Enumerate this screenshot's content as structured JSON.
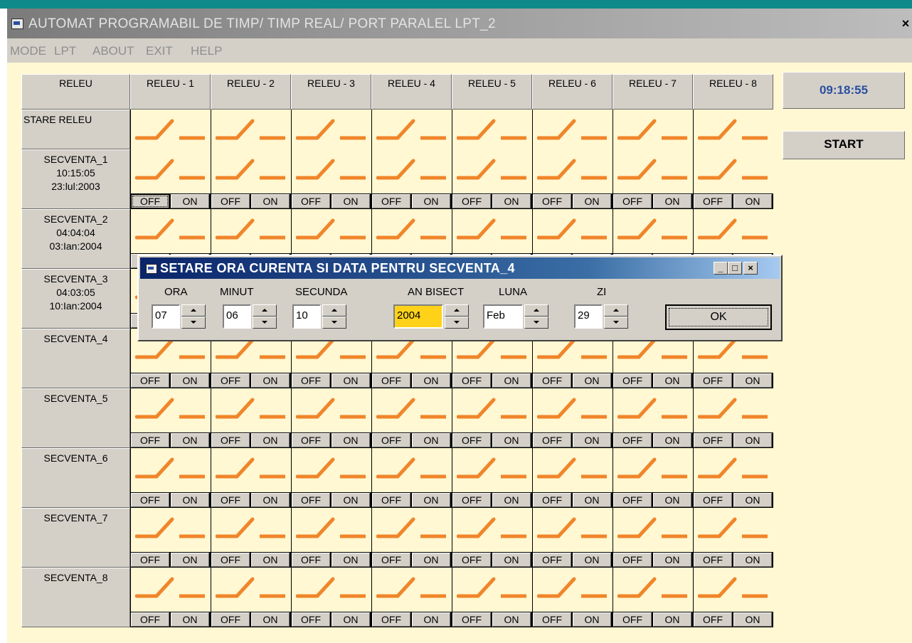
{
  "window": {
    "title": "AUTOMAT PROGRAMABIL DE TIMP/ TIMP REAL/ PORT PARALEL LPT_2",
    "close_glyph": "×"
  },
  "menu": [
    {
      "label": "MODE"
    },
    {
      "label": "LPT"
    },
    {
      "label": "ABOUT"
    },
    {
      "label": "EXIT"
    },
    {
      "label": "HELP"
    }
  ],
  "grid": {
    "corner_label": "RELEU",
    "relays": [
      "RELEU - 1",
      "RELEU - 2",
      "RELEU - 3",
      "RELEU - 4",
      "RELEU - 5",
      "RELEU - 6",
      "RELEU - 7",
      "RELEU - 8"
    ],
    "state_row_label": "STARE RELEU",
    "off_label": "OFF",
    "on_label": "ON",
    "sequences": [
      {
        "name": "SECVENTA_1",
        "time": "10:15:05",
        "date": "23:lul:2003"
      },
      {
        "name": "SECVENTA_2",
        "time": "04:04:04",
        "date": "03:Ian:2004"
      },
      {
        "name": "SECVENTA_3",
        "time": "04:03:05",
        "date": "10:Ian:2004"
      },
      {
        "name": "SECVENTA_4",
        "time": "",
        "date": ""
      },
      {
        "name": "SECVENTA_5",
        "time": "",
        "date": ""
      },
      {
        "name": "SECVENTA_6",
        "time": "",
        "date": ""
      },
      {
        "name": "SECVENTA_7",
        "time": "",
        "date": ""
      },
      {
        "name": "SECVENTA_8",
        "time": "",
        "date": ""
      }
    ]
  },
  "clock": "09:18:55",
  "start_label": "START",
  "dialog": {
    "title": "SETARE ORA CURENTA SI DATA PENTRU SECVENTA_4",
    "fields": [
      {
        "label": "ORA",
        "value": "07"
      },
      {
        "label": "MINUT",
        "value": "06"
      },
      {
        "label": "SECUNDA",
        "value": "10"
      },
      {
        "label": "AN BISECT",
        "value": "2004"
      },
      {
        "label": "LUNA",
        "value": "Feb"
      },
      {
        "label": "ZI",
        "value": "29"
      }
    ],
    "ok_label": "OK",
    "minimize_glyph": "_",
    "maximize_glyph": "□",
    "close_glyph": "×"
  },
  "colors": {
    "relay_symbol": "#f0852a",
    "client_bg": "#fff8d2",
    "highlight_field": "#ffd219",
    "clock_text": "#2a4fa0",
    "dialog_title": "#0a246a"
  }
}
